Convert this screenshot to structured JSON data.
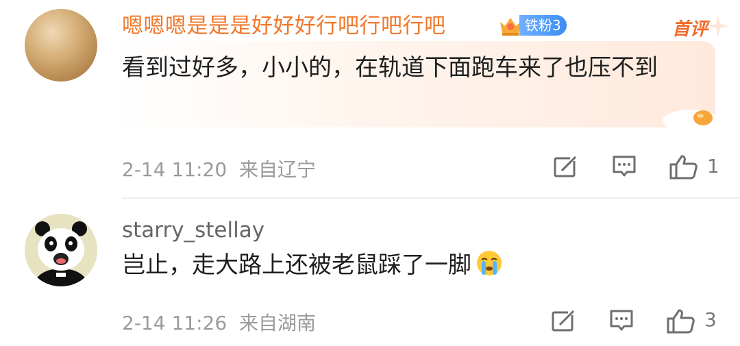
{
  "comments": [
    {
      "username": "嗯嗯嗯是是是好好好行吧行吧行吧",
      "badge_text": "铁粉3",
      "tag": "首评",
      "content": "看到过好多，小小的，在轨道下面跑车来了也压不到",
      "time": "2-14 11:20",
      "location": "来自辽宁",
      "likes": "1",
      "colors": {
        "username": "#f0782a",
        "badge": "#3d8df5",
        "tag": "#f06a2a"
      }
    },
    {
      "username": "starry_stellay",
      "content": "岂止，走大路上还被老鼠踩了一脚",
      "time": "2-14 11:26",
      "location": "来自湖南",
      "likes": "3",
      "colors": {
        "username": "#666666"
      }
    }
  ],
  "icons": [
    "share-icon",
    "reply-icon",
    "like-icon",
    "crown-icon",
    "egg-icon",
    "crying-face-icon",
    "panda-avatar"
  ]
}
